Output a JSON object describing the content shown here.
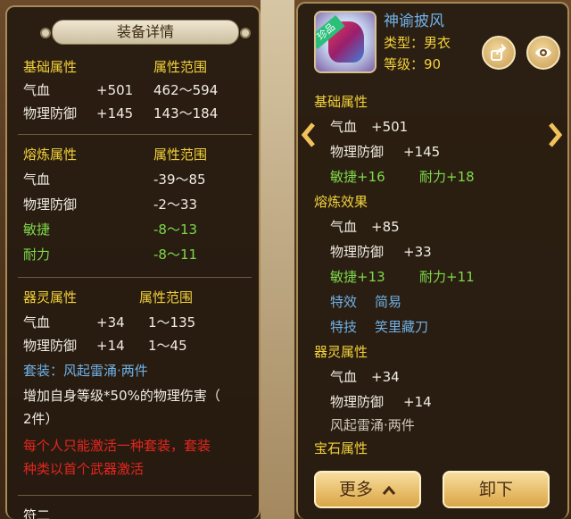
{
  "left_panel": {
    "title": "装备详情",
    "base": {
      "header_attr": "基础属性",
      "header_range": "属性范围",
      "rows": [
        {
          "name": "气血",
          "value": "+501",
          "range": "462～594"
        },
        {
          "name": "物理防御",
          "value": "+145",
          "range": "143～184"
        }
      ]
    },
    "smelt": {
      "header_attr": "熔炼属性",
      "header_range": "属性范围",
      "rows": [
        {
          "name": "气血",
          "range": "-39～85"
        },
        {
          "name": "物理防御",
          "range": "-2～33"
        },
        {
          "name": "敏捷",
          "range": "-8～13"
        },
        {
          "name": "耐力",
          "range": "-8～11"
        }
      ]
    },
    "spirit": {
      "header_attr": "器灵属性",
      "header_range": "属性范围",
      "rows": [
        {
          "name": "气血",
          "value": "+34",
          "range": "1～135"
        },
        {
          "name": "物理防御",
          "value": "+14",
          "range": "1～45"
        }
      ]
    },
    "set_line": "套装：风起雷涌·两件",
    "set_desc_1": "增加自身等级*50%的物理伤害（",
    "set_desc_2": "2件）",
    "red_line_1": "每个人只能激活一种套装，套装",
    "red_line_2": "种类以首个武器激活",
    "bottom_cut": "符二"
  },
  "right_panel": {
    "item_name": "神谕披风",
    "badge": "珍品",
    "type_line": "类型：男衣",
    "level_line": "等级：90",
    "base_header": "基础属性",
    "base_rows": [
      {
        "name": "气血",
        "value": "+501"
      },
      {
        "name": "物理防御",
        "value": "+145"
      }
    ],
    "base_extra": [
      {
        "label": "敏捷+16"
      },
      {
        "label": "耐力+18"
      }
    ],
    "smelt_header": "熔炼效果",
    "smelt_rows": [
      {
        "name": "气血",
        "value": "+85"
      },
      {
        "name": "物理防御",
        "value": "+33"
      }
    ],
    "smelt_extra": [
      {
        "label": "敏捷+13"
      },
      {
        "label": "耐力+11"
      }
    ],
    "effect_label": "特效",
    "effect_value": "简易",
    "skill_label": "特技",
    "skill_value": "笑里藏刀",
    "spirit_header": "器灵属性",
    "spirit_rows": [
      {
        "name": "气血",
        "value": "+34"
      },
      {
        "name": "物理防御",
        "value": "+14"
      }
    ],
    "set_name": "风起雷涌·两件",
    "gem_header": "宝石属性",
    "more_button": "更多",
    "unequip_button": "卸下"
  },
  "icons": {
    "share": "share-icon",
    "eye": "eye-icon",
    "prev": "chevron-left-icon",
    "next": "chevron-right-icon",
    "more_arrow": "chevron-up-icon"
  },
  "colors": {
    "header_yellow": "#f2d23a",
    "value_white": "#f1ede2",
    "positive_green": "#7ed94a",
    "link_blue": "#6fb2e8",
    "warning_red": "#e3261f",
    "button_gold": "#e8bf6c"
  }
}
